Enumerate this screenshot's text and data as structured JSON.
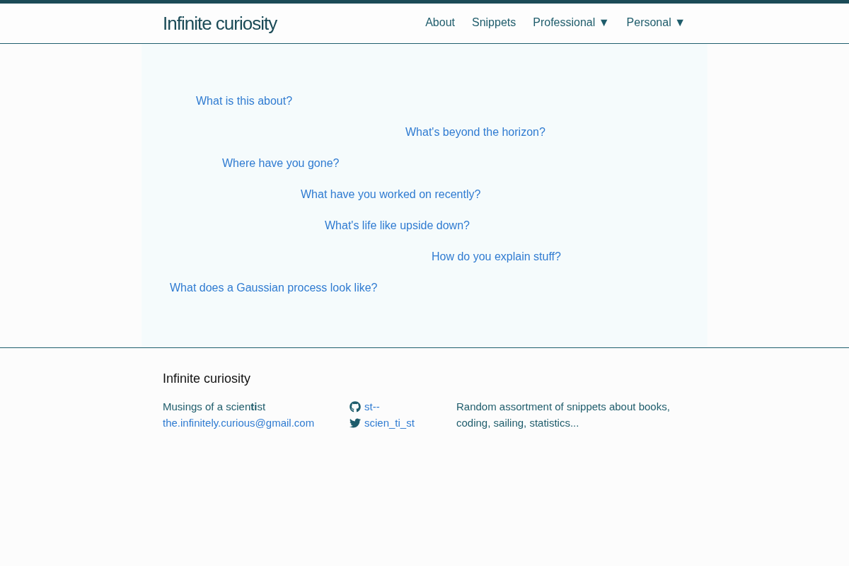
{
  "header": {
    "title": "Infinite curiosity",
    "nav": [
      {
        "label": "About"
      },
      {
        "label": "Snippets"
      },
      {
        "label": "Professional",
        "caret": "▼"
      },
      {
        "label": "Personal",
        "caret": "▼"
      }
    ]
  },
  "questions": [
    "What is this about?",
    "What's beyond the horizon?",
    "Where have you gone?",
    "What have you worked on recently?",
    "What's life like upside down?",
    "How do you explain stuff?",
    "What does a Gaussian process look like?"
  ],
  "footer": {
    "title": "Infinite curiosity",
    "tagline": "Musings of a scien**ti**st",
    "email": "the.infinitely.curious@gmail.com",
    "social": [
      {
        "kind": "github",
        "handle": "st--"
      },
      {
        "kind": "twitter",
        "handle": "scien_ti_st"
      }
    ],
    "description": "Random assortment of snippets about books, coding, sailing, statistics..."
  }
}
